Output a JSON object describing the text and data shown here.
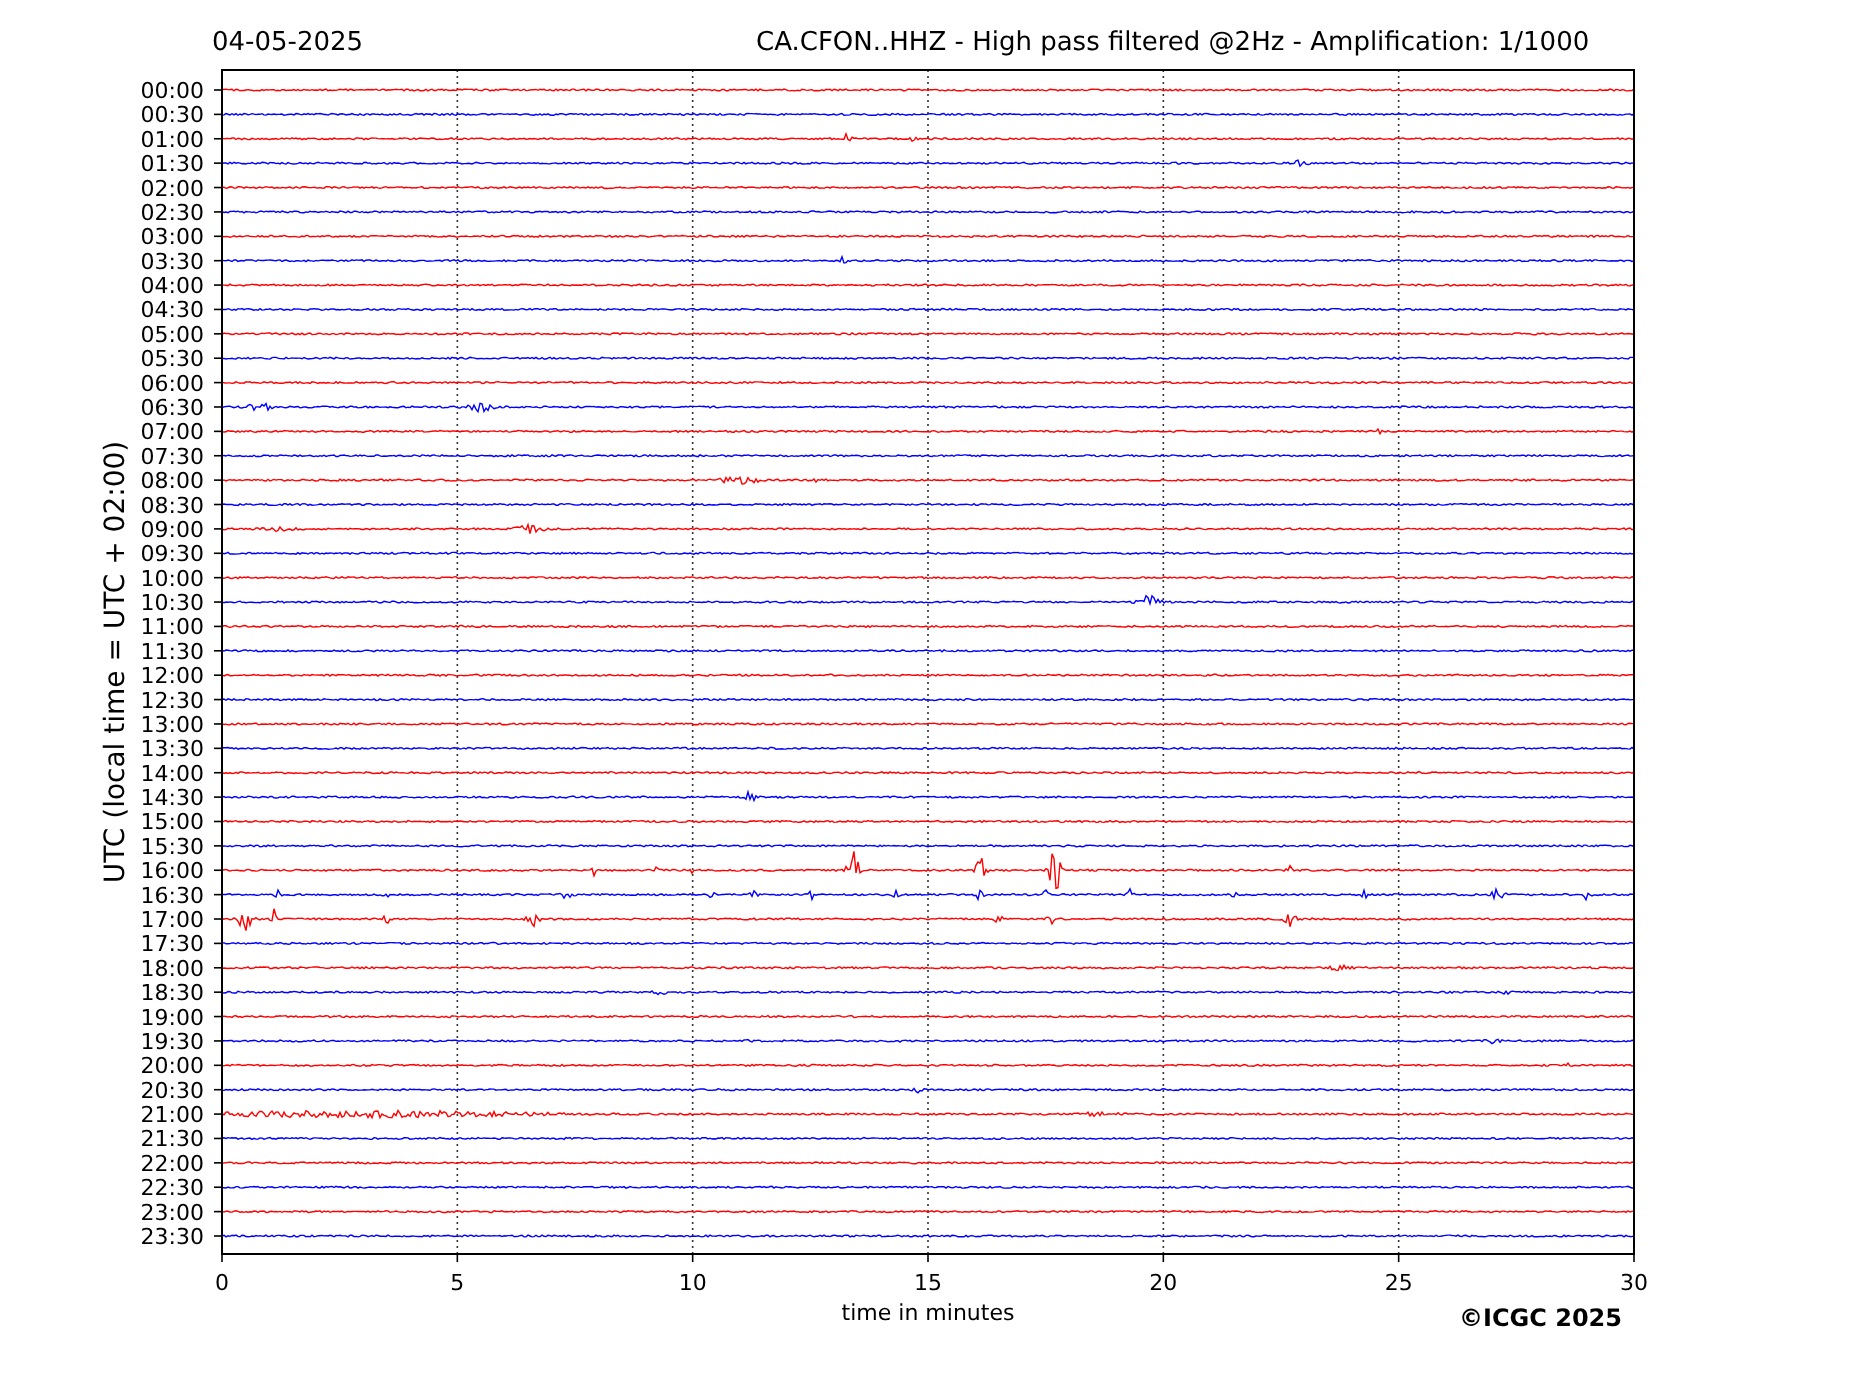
{
  "header": {
    "date": "04-05-2025",
    "title": "CA.CFON..HHZ - High pass filtered @2Hz - Amplification: 1/1000"
  },
  "helicorder": {
    "ylabel": "UTC (local time = UTC + 02:00)",
    "xlabel": "time in minutes",
    "xticks": [
      "0",
      "5",
      "10",
      "15",
      "20",
      "25",
      "30"
    ],
    "rows": [
      {
        "label": "00:00",
        "color": "#ff0000"
      },
      {
        "label": "00:30",
        "color": "#0000ff"
      },
      {
        "label": "01:00",
        "color": "#ff0000"
      },
      {
        "label": "01:30",
        "color": "#0000ff"
      },
      {
        "label": "02:00",
        "color": "#ff0000"
      },
      {
        "label": "02:30",
        "color": "#0000ff"
      },
      {
        "label": "03:00",
        "color": "#ff0000"
      },
      {
        "label": "03:30",
        "color": "#0000ff"
      },
      {
        "label": "04:00",
        "color": "#ff0000"
      },
      {
        "label": "04:30",
        "color": "#0000ff"
      },
      {
        "label": "05:00",
        "color": "#ff0000"
      },
      {
        "label": "05:30",
        "color": "#0000ff"
      },
      {
        "label": "06:00",
        "color": "#ff0000"
      },
      {
        "label": "06:30",
        "color": "#0000ff"
      },
      {
        "label": "07:00",
        "color": "#ff0000"
      },
      {
        "label": "07:30",
        "color": "#0000ff"
      },
      {
        "label": "08:00",
        "color": "#ff0000"
      },
      {
        "label": "08:30",
        "color": "#0000ff"
      },
      {
        "label": "09:00",
        "color": "#ff0000"
      },
      {
        "label": "09:30",
        "color": "#0000ff"
      },
      {
        "label": "10:00",
        "color": "#ff0000"
      },
      {
        "label": "10:30",
        "color": "#0000ff"
      },
      {
        "label": "11:00",
        "color": "#ff0000"
      },
      {
        "label": "11:30",
        "color": "#0000ff"
      },
      {
        "label": "12:00",
        "color": "#ff0000"
      },
      {
        "label": "12:30",
        "color": "#0000ff"
      },
      {
        "label": "13:00",
        "color": "#ff0000"
      },
      {
        "label": "13:30",
        "color": "#0000ff"
      },
      {
        "label": "14:00",
        "color": "#ff0000"
      },
      {
        "label": "14:30",
        "color": "#0000ff"
      },
      {
        "label": "15:00",
        "color": "#ff0000"
      },
      {
        "label": "15:30",
        "color": "#0000ff"
      },
      {
        "label": "16:00",
        "color": "#ff0000"
      },
      {
        "label": "16:30",
        "color": "#0000ff"
      },
      {
        "label": "17:00",
        "color": "#ff0000"
      },
      {
        "label": "17:30",
        "color": "#0000ff"
      },
      {
        "label": "18:00",
        "color": "#ff0000"
      },
      {
        "label": "18:30",
        "color": "#0000ff"
      },
      {
        "label": "19:00",
        "color": "#ff0000"
      },
      {
        "label": "19:30",
        "color": "#0000ff"
      },
      {
        "label": "20:00",
        "color": "#ff0000"
      },
      {
        "label": "20:30",
        "color": "#0000ff"
      },
      {
        "label": "21:00",
        "color": "#ff0000"
      },
      {
        "label": "21:30",
        "color": "#0000ff"
      },
      {
        "label": "22:00",
        "color": "#ff0000"
      },
      {
        "label": "22:30",
        "color": "#0000ff"
      },
      {
        "label": "23:00",
        "color": "#ff0000"
      },
      {
        "label": "23:30",
        "color": "#0000ff"
      }
    ]
  },
  "credit": "©ICGC 2025"
}
